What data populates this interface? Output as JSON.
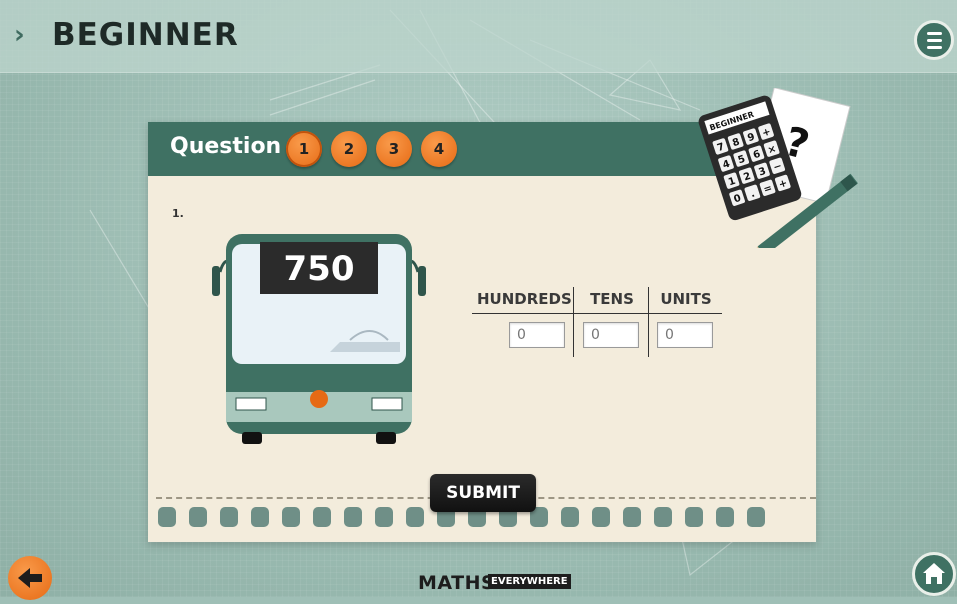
{
  "header": {
    "chevron": "›",
    "title": "BEGINNER"
  },
  "question_bar": {
    "label": "Question",
    "items": [
      "1",
      "2",
      "3",
      "4"
    ],
    "active_index": 0
  },
  "question": {
    "number": "1.",
    "bus_number": "750"
  },
  "place_value": {
    "columns": [
      "HUNDREDS",
      "TENS",
      "UNITS"
    ],
    "values": [
      "0",
      "0",
      "0"
    ]
  },
  "submit_label": "SUBMIT",
  "badge": {
    "text": "BEGINNER",
    "mark": "?",
    "keys": [
      "7",
      "8",
      "9",
      "+",
      "4",
      "5",
      "6",
      "×",
      "1",
      "2",
      "3",
      "−",
      "0",
      ".",
      "=",
      "+"
    ]
  },
  "logo": {
    "main": "MATHS",
    "sub": "EVERYWHERE"
  },
  "colors": {
    "primary": "#3f7163",
    "accent": "#e66a14",
    "paper": "#f3ecdc",
    "background": "#9fbfb6"
  }
}
